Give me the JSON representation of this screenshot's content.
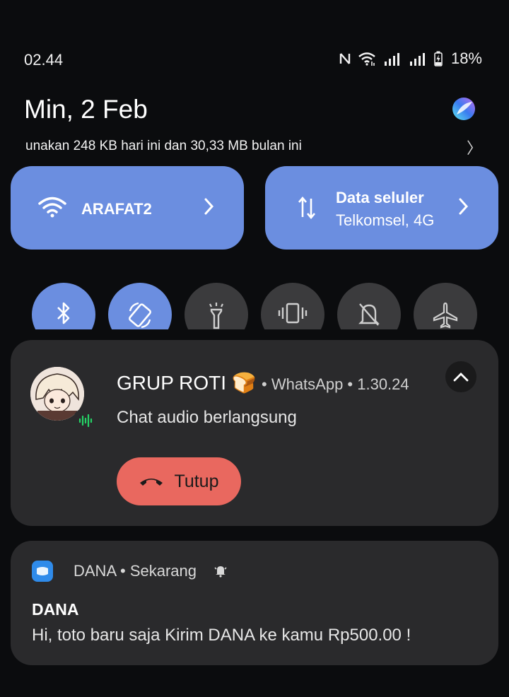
{
  "status_bar": {
    "time": "02.44",
    "battery_percent": "18%",
    "icons": [
      "nfc-icon",
      "wifi-icon",
      "signal-icon",
      "signal-icon",
      "battery-charging-icon"
    ]
  },
  "header": {
    "date": "Min, 2 Feb",
    "data_usage": "unakan 248 KB hari ini dan 30,33 MB bulan ini",
    "usage_chevron": "〉"
  },
  "tiles": {
    "wifi": {
      "label": "ARAFAT2"
    },
    "mobile_data": {
      "label": "Data seluler",
      "sub": "Telkomsel, 4G"
    }
  },
  "quick_settings": [
    {
      "name": "bluetooth",
      "on": true
    },
    {
      "name": "auto-rotate",
      "on": true
    },
    {
      "name": "flashlight",
      "on": false
    },
    {
      "name": "vibrate",
      "on": false
    },
    {
      "name": "do-not-disturb",
      "on": false
    },
    {
      "name": "airplane-mode",
      "on": false
    }
  ],
  "whatsapp_notification": {
    "title": "GRUP ROTI 🍞",
    "meta": "• WhatsApp • 1.30.24",
    "body": "Chat audio berlangsung",
    "action_label": "Tutup"
  },
  "dana_notification": {
    "app_line": "DANA • Sekarang",
    "title": "DANA",
    "body": "Hi, toto baru saja Kirim DANA ke kamu Rp500.00 !"
  },
  "colors": {
    "accent_tile": "#6b8ee0",
    "card_bg": "#2a2a2c",
    "hangup": "#e9685f",
    "background": "#0b0c0e"
  }
}
